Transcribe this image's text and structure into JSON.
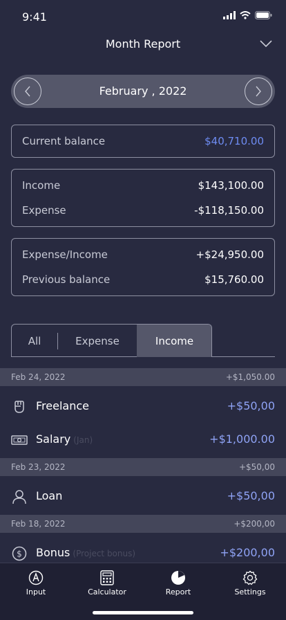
{
  "status_bar": {
    "time": "9:41"
  },
  "header": {
    "title": "Month Report"
  },
  "month_picker": {
    "label": "February , 2022"
  },
  "balance_card": {
    "label": "Current balance",
    "value": "$40,710.00"
  },
  "totals_card": {
    "income_label": "Income",
    "income_value": "$143,100.00",
    "expense_label": "Expense",
    "expense_value": "-$118,150.00"
  },
  "summary_card": {
    "ratio_label": "Expense/Income",
    "ratio_value": "+$24,950.00",
    "prev_label": "Previous balance",
    "prev_value": "$15,760.00"
  },
  "tabs": {
    "all": "All",
    "expense": "Expense",
    "income": "Income",
    "selected": "Income"
  },
  "groups": [
    {
      "date": "Feb 24, 2022",
      "total": "+$1,050.00",
      "items": [
        {
          "icon": "fist-icon",
          "name": "Freelance",
          "note": "",
          "amount": "+$50,00"
        },
        {
          "icon": "cash-icon",
          "name": "Salary",
          "note": "(Jan)",
          "amount": "+$1,000.00"
        }
      ]
    },
    {
      "date": "Feb 23, 2022",
      "total": "+$50,00",
      "items": [
        {
          "icon": "person-icon",
          "name": "Loan",
          "note": "",
          "amount": "+$50,00"
        }
      ]
    },
    {
      "date": "Feb 18, 2022",
      "total": "+$200,00",
      "items": [
        {
          "icon": "dollar-coin-icon",
          "name": "Bonus",
          "note": "(Project bonus)",
          "amount": "+$200,00"
        }
      ]
    }
  ],
  "tab_bar": {
    "input": "Input",
    "calculator": "Calculator",
    "report": "Report",
    "settings": "Settings"
  },
  "colors": {
    "background": "#282a40",
    "accent_blue": "#6e8cf2",
    "income_blue": "#8fa3f5"
  }
}
